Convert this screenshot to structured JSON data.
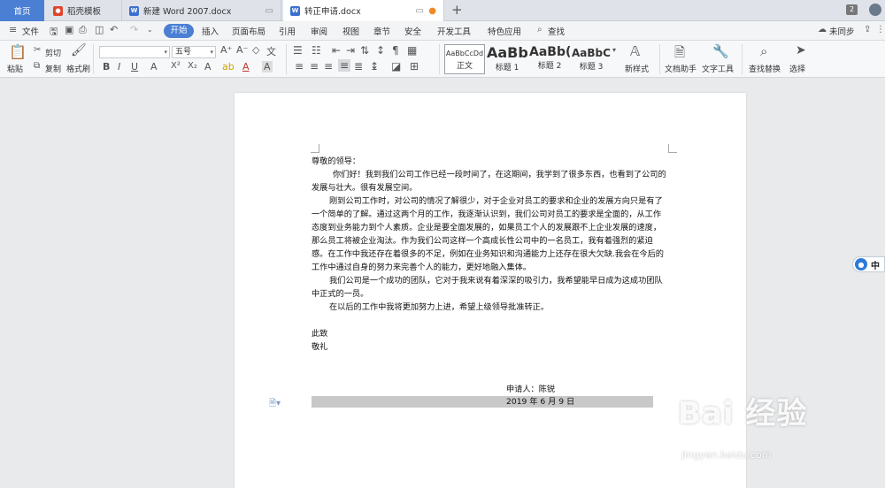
{
  "tabs": {
    "home": "首页",
    "templates": "稻壳模板",
    "doc1": "新建 Word 2007.docx",
    "doc2": "转正申请.docx",
    "badge": "2"
  },
  "menu": {
    "file": "文件",
    "start": "开始",
    "items": [
      "插入",
      "页面布局",
      "引用",
      "审阅",
      "视图",
      "章节",
      "安全",
      "开发工具",
      "特色应用",
      "查找"
    ],
    "sync": "未同步"
  },
  "ribbon": {
    "paste": "粘贴",
    "cut": "剪切",
    "copy": "复制",
    "format_painter": "格式刷",
    "font_size": "五号",
    "styles": [
      {
        "preview": "AaBbCcDd",
        "label": "正文"
      },
      {
        "preview": "AaBb",
        "label": "标题 1"
      },
      {
        "preview": "AaBb(",
        "label": "标题 2"
      },
      {
        "preview": "AaBbC(",
        "label": "标题 3"
      }
    ],
    "new_style": "新样式",
    "doc_assistant": "文档助手",
    "text_tools": "文字工具",
    "find_replace": "查找替换",
    "select": "选择"
  },
  "document": {
    "greeting": "尊敬的领导：",
    "para1": "你们好！我到我们公司工作已经一段时间了，在这期间，我学到了很多东西，也看到了公司的发展与壮大。很有发展空间。",
    "para2": "刚到公司工作时，对公司的情况了解很少，对于企业对员工的要求和企业的发展方向只是有了一个简单的了解。通过这两个月的工作，我逐渐认识到，我们公司对员工的要求是全面的，从工作态度到业务能力到个人素质。企业是要全面发展的，如果员工个人的发展跟不上企业发展的速度，那么员工将被企业淘汰。作为我们公司这样一个高成长性公司中的一名员工，我有着强烈的紧迫感。在工作中我还存在着很多的不足，例如在业务知识和沟通能力上还存在很大欠缺.我会在今后的工作中通过自身的努力来完善个人的能力，更好地融入集体。",
    "para3": "我们公司是一个成功的团队，它对于我来说有着深深的吸引力，我希望能早日成为这成功团队中正式的一员。",
    "para4": "在以后的工作中我将更加努力上进，希望上级领导批准转正。",
    "closing1": "此致",
    "closing2": "敬礼",
    "applicant": "申请人：陈锐",
    "date": "2019 年 6 月 9 日"
  },
  "side_ime": "中",
  "watermark": {
    "logo": "Bai  经验",
    "url": "jingyan.baidu.com"
  },
  "colors": {
    "accent": "#4a7fd4",
    "tab_bg": "#dfe3e9",
    "canvas": "#e9eaec"
  }
}
